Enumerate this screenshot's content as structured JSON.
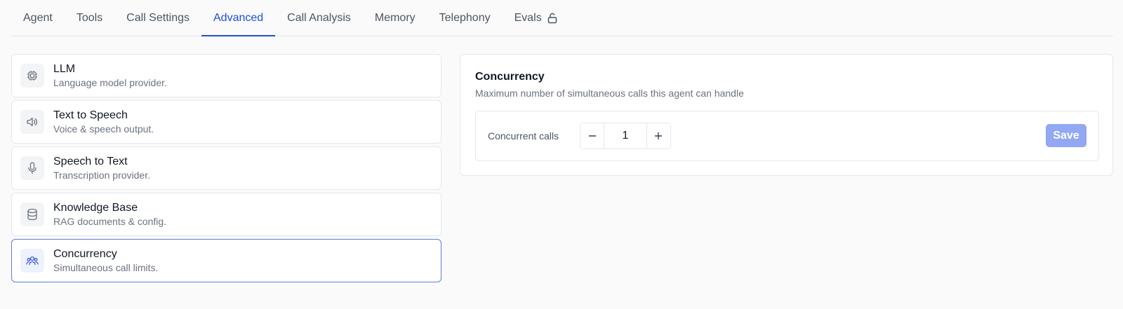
{
  "tabs": [
    {
      "label": "Agent"
    },
    {
      "label": "Tools"
    },
    {
      "label": "Call Settings"
    },
    {
      "label": "Advanced"
    },
    {
      "label": "Call Analysis"
    },
    {
      "label": "Memory"
    },
    {
      "label": "Telephony"
    },
    {
      "label": "Evals",
      "icon": "lock-icon"
    }
  ],
  "active_tab": "Advanced",
  "sections": [
    {
      "title": "LLM",
      "description": "Language model provider.",
      "icon": "chip-icon"
    },
    {
      "title": "Text to Speech",
      "description": "Voice & speech output.",
      "icon": "speaker-icon"
    },
    {
      "title": "Speech to Text",
      "description": "Transcription provider.",
      "icon": "microphone-icon"
    },
    {
      "title": "Knowledge Base",
      "description": "RAG documents & config.",
      "icon": "database-icon"
    },
    {
      "title": "Concurrency",
      "description": "Simultaneous call limits.",
      "icon": "users-icon"
    }
  ],
  "active_section": "Concurrency",
  "panel": {
    "title": "Concurrency",
    "description": "Maximum number of simultaneous calls this agent can handle",
    "field_label": "Concurrent calls",
    "value": "1",
    "save_label": "Save"
  },
  "colors": {
    "accent": "#1d4ed8",
    "active_border": "#5b7fe0",
    "save_disabled": "#93a8f2"
  }
}
